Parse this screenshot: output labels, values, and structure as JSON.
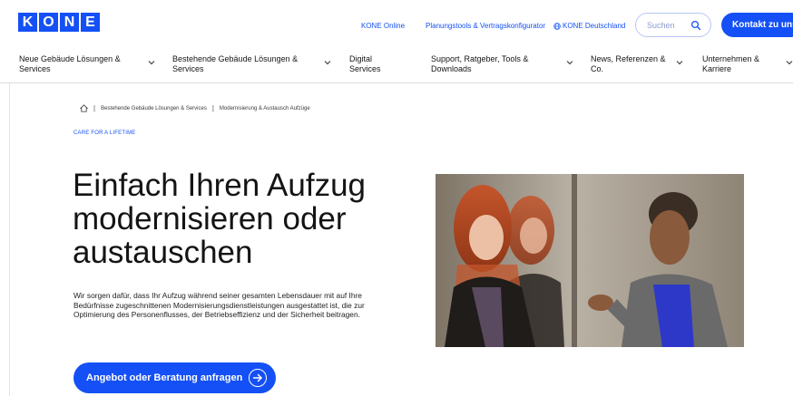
{
  "brand": {
    "logo_letters": [
      "K",
      "O",
      "N",
      "E"
    ],
    "color": "#1450f5"
  },
  "utility_links": {
    "kone_online": "KONE Online",
    "planning_tools": "Planungstools & Vertragskonfigurator",
    "country": "KONE Deutschland"
  },
  "search": {
    "placeholder": "Suchen"
  },
  "contact_button": "Kontakt zu uns",
  "nav": {
    "items": [
      {
        "line1": "Neue Gebäude Lösungen &",
        "line2": "Services",
        "has_dropdown": true
      },
      {
        "line1": "Bestehende Gebäude Lösungen &",
        "line2": "Services",
        "has_dropdown": true
      },
      {
        "line1": "Digital",
        "line2": "Services",
        "has_dropdown": false
      },
      {
        "line1": "Support, Ratgeber, Tools &",
        "line2": "Downloads",
        "has_dropdown": true
      },
      {
        "line1": "News, Referenzen &",
        "line2": "Co.",
        "has_dropdown": true
      },
      {
        "line1": "Unternehmen &",
        "line2": "Karriere",
        "has_dropdown": true
      }
    ]
  },
  "breadcrumb": {
    "items": [
      "Bestehende Gebäude Lösungen & Services",
      "Modernisierung & Austausch Aufzüge"
    ]
  },
  "hero": {
    "eyebrow": "CARE FOR A LIFETIME",
    "headline": "Einfach Ihren Aufzug modernisieren oder austauschen",
    "description": "Wir sorgen dafür, dass Ihr Aufzug während seiner gesamten Lebensdauer mit auf Ihre Bedürfnisse zugeschnittenen Modernisierungsdienstleistungen ausgestattet ist, die zur Optimierung des Personenflusses, der Betriebseffizienz und der Sicherheit beitragen.",
    "cta": "Angebot oder Beratung anfragen"
  }
}
